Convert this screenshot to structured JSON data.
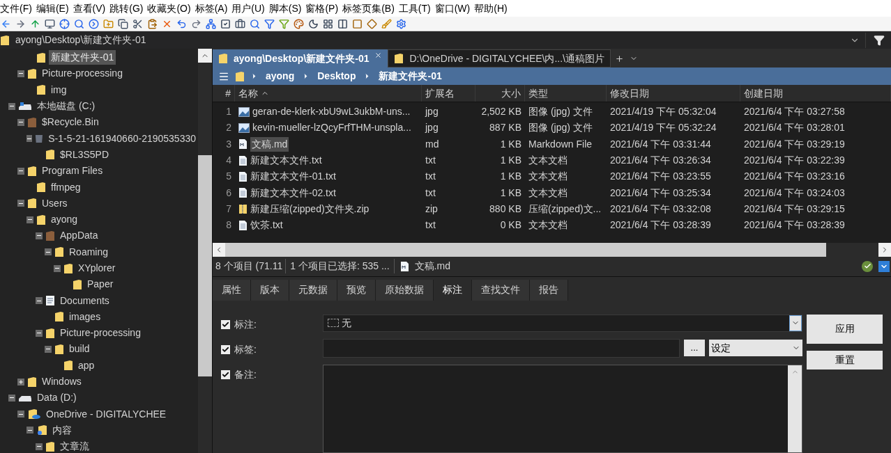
{
  "menu": [
    "文件(F)",
    "编辑(E)",
    "查看(V)",
    "跳转(G)",
    "收藏夹(O)",
    "标签(A)",
    "用户(U)",
    "脚本(S)",
    "窗格(P)",
    "标签页集(B)",
    "工具(T)",
    "窗口(W)",
    "帮助(H)"
  ],
  "address": {
    "value": "ayong\\Desktop\\新建文件夹-01"
  },
  "tree": [
    {
      "children": [
        {
          "children": [
            {
              "label": "新建文件夹-01",
              "kind": "folder",
              "selected": true
            }
          ]
        },
        {
          "label": "Picture-processing",
          "kind": "folder",
          "selected": false,
          "expanded": true,
          "children": [
            {
              "label": "img",
              "kind": "folder",
              "selected": false
            }
          ]
        }
      ]
    },
    {
      "label": "本地磁盘 (C:)",
      "kind": "system-drive",
      "selected": false,
      "expanded": true,
      "children": [
        {
          "label": "$Recycle.Bin",
          "kind": "special-folder",
          "selected": false,
          "expanded": true,
          "children": [
            {
              "label": "S-1-5-21-161940660-2190535330",
              "kind": "recycle-bin",
              "selected": false,
              "expanded": true,
              "children": [
                {
                  "label": "$RL3S5PD",
                  "kind": "folder",
                  "selected": false
                }
              ]
            }
          ]
        },
        {
          "label": "Program Files",
          "kind": "folder",
          "selected": false,
          "expanded": true,
          "children": [
            {
              "label": "ffmpeg",
              "kind": "folder",
              "selected": false
            }
          ]
        },
        {
          "label": "Users",
          "kind": "folder",
          "selected": false,
          "expanded": true,
          "children": [
            {
              "label": "ayong",
              "kind": "folder",
              "selected": false,
              "expanded": true,
              "children": [
                {
                  "label": "AppData",
                  "kind": "special-folder",
                  "selected": false,
                  "expanded": true,
                  "children": [
                    {
                      "label": "Roaming",
                      "kind": "folder",
                      "selected": false,
                      "expanded": true,
                      "children": [
                        {
                          "label": "XYplorer",
                          "kind": "folder",
                          "selected": false,
                          "expanded": true,
                          "children": [
                            {
                              "label": "Paper",
                              "kind": "folder",
                              "selected": false
                            }
                          ]
                        }
                      ]
                    }
                  ]
                },
                {
                  "label": "Documents",
                  "kind": "documents",
                  "selected": false,
                  "expanded": true,
                  "children": [
                    {
                      "label": "images",
                      "kind": "folder",
                      "selected": false
                    }
                  ]
                },
                {
                  "label": "Picture-processing",
                  "kind": "folder",
                  "selected": false,
                  "expanded": true,
                  "children": [
                    {
                      "label": "build",
                      "kind": "folder",
                      "selected": false,
                      "expanded": true,
                      "children": [
                        {
                          "label": "app",
                          "kind": "folder",
                          "selected": false
                        }
                      ]
                    }
                  ]
                }
              ]
            }
          ]
        },
        {
          "label": "Windows",
          "kind": "folder",
          "selected": false,
          "expanded": false
        }
      ]
    },
    {
      "label": "Data (D:)",
      "kind": "drive",
      "selected": false,
      "expanded": true,
      "children": [
        {
          "label": "OneDrive - DIGITALYCHEE",
          "kind": "cloud-folder",
          "selected": false,
          "expanded": true,
          "children": [
            {
              "label": "内容",
              "kind": "link-folder",
              "selected": false,
              "expanded": true,
              "children": [
                {
                  "label": "文章流",
                  "kind": "folder",
                  "selected": false,
                  "expanded": true
                }
              ]
            }
          ]
        }
      ]
    }
  ],
  "tabs": [
    {
      "label": "ayong\\Desktop\\新建文件夹-01",
      "selected": true
    },
    {
      "label": "D:\\OneDrive - DIGITALYCHEE\\内...\\通稿图片",
      "selected": false
    }
  ],
  "breadcrumb": [
    "ayong",
    "Desktop",
    "新建文件夹-01"
  ],
  "columns": [
    {
      "label": "#",
      "sorted": false
    },
    {
      "label": "名称",
      "sorted": true
    },
    {
      "label": "扩展名",
      "sorted": false
    },
    {
      "label": "大小",
      "sorted": false
    },
    {
      "label": "类型",
      "sorted": false
    },
    {
      "label": "修改日期",
      "sorted": false
    },
    {
      "label": "创建日期",
      "sorted": false
    }
  ],
  "rows": [
    {
      "num": "1",
      "name": "geran-de-klerk-xbU9wL3ukbM-uns...",
      "kind": "image",
      "ext": "jpg",
      "size": "2,502 KB",
      "type": "图像 (jpg) 文件",
      "modified": "2021/4/19 下午 05:32:04",
      "created": "2021/6/4 下午 03:27:58",
      "selected": false
    },
    {
      "num": "2",
      "name": "kevin-mueller-lzQcyFrfTHM-unspla...",
      "kind": "image",
      "ext": "jpg",
      "size": "887 KB",
      "type": "图像 (jpg) 文件",
      "modified": "2021/4/19 下午 05:32:24",
      "created": "2021/6/4 下午 03:28:01",
      "selected": false
    },
    {
      "num": "3",
      "name": "文稿.md",
      "kind": "markdown",
      "ext": "md",
      "size": "1 KB",
      "type": "Markdown File",
      "modified": "2021/6/4 下午 03:31:44",
      "created": "2021/6/4 下午 03:29:19",
      "selected": true
    },
    {
      "num": "4",
      "name": "新建文本文件.txt",
      "kind": "text",
      "ext": "txt",
      "size": "1 KB",
      "type": "文本文档",
      "modified": "2021/6/4 下午 03:26:34",
      "created": "2021/6/4 下午 03:22:39",
      "selected": false
    },
    {
      "num": "5",
      "name": "新建文本文件-01.txt",
      "kind": "text",
      "ext": "txt",
      "size": "1 KB",
      "type": "文本文档",
      "modified": "2021/6/4 下午 03:23:55",
      "created": "2021/6/4 下午 03:23:16",
      "selected": false
    },
    {
      "num": "6",
      "name": "新建文本文件-02.txt",
      "kind": "text",
      "ext": "txt",
      "size": "1 KB",
      "type": "文本文档",
      "modified": "2021/6/4 下午 03:25:34",
      "created": "2021/6/4 下午 03:24:03",
      "selected": false
    },
    {
      "num": "7",
      "name": "新建压缩(zipped)文件夹.zip",
      "kind": "zip",
      "ext": "zip",
      "size": "880 KB",
      "type": "压缩(zipped)文...",
      "modified": "2021/6/4 下午 03:32:08",
      "created": "2021/6/4 下午 03:29:15",
      "selected": false
    },
    {
      "num": "8",
      "name": "饮茶.txt",
      "kind": "text",
      "ext": "txt",
      "size": "0 KB",
      "type": "文本文档",
      "modified": "2021/6/4 下午 03:28:39",
      "created": "2021/6/4 下午 03:28:39",
      "selected": false
    }
  ],
  "status": {
    "count": "8 个项目 (71.11",
    "selection": "1 个项目已选择: 535 ...",
    "file": "文稿.md"
  },
  "info_tabs": [
    {
      "label": "属性",
      "selected": false
    },
    {
      "label": "版本",
      "selected": false
    },
    {
      "label": "元数据",
      "selected": false
    },
    {
      "label": "预览",
      "selected": false
    },
    {
      "label": "原始数据",
      "selected": false
    },
    {
      "label": "标注",
      "selected": true
    },
    {
      "label": "查找文件",
      "selected": false
    },
    {
      "label": "报告",
      "selected": false
    }
  ],
  "tag_panel": {
    "fields": [
      {
        "kind": "dropdown",
        "label": "标注:",
        "checked": true,
        "value": "无"
      },
      {
        "kind": "tags",
        "label": "标签:",
        "checked": true,
        "browse": "...",
        "mode": "设定"
      },
      {
        "kind": "memo",
        "label": "备注:",
        "checked": true
      }
    ],
    "buttons": [
      "应用",
      "重置"
    ]
  }
}
